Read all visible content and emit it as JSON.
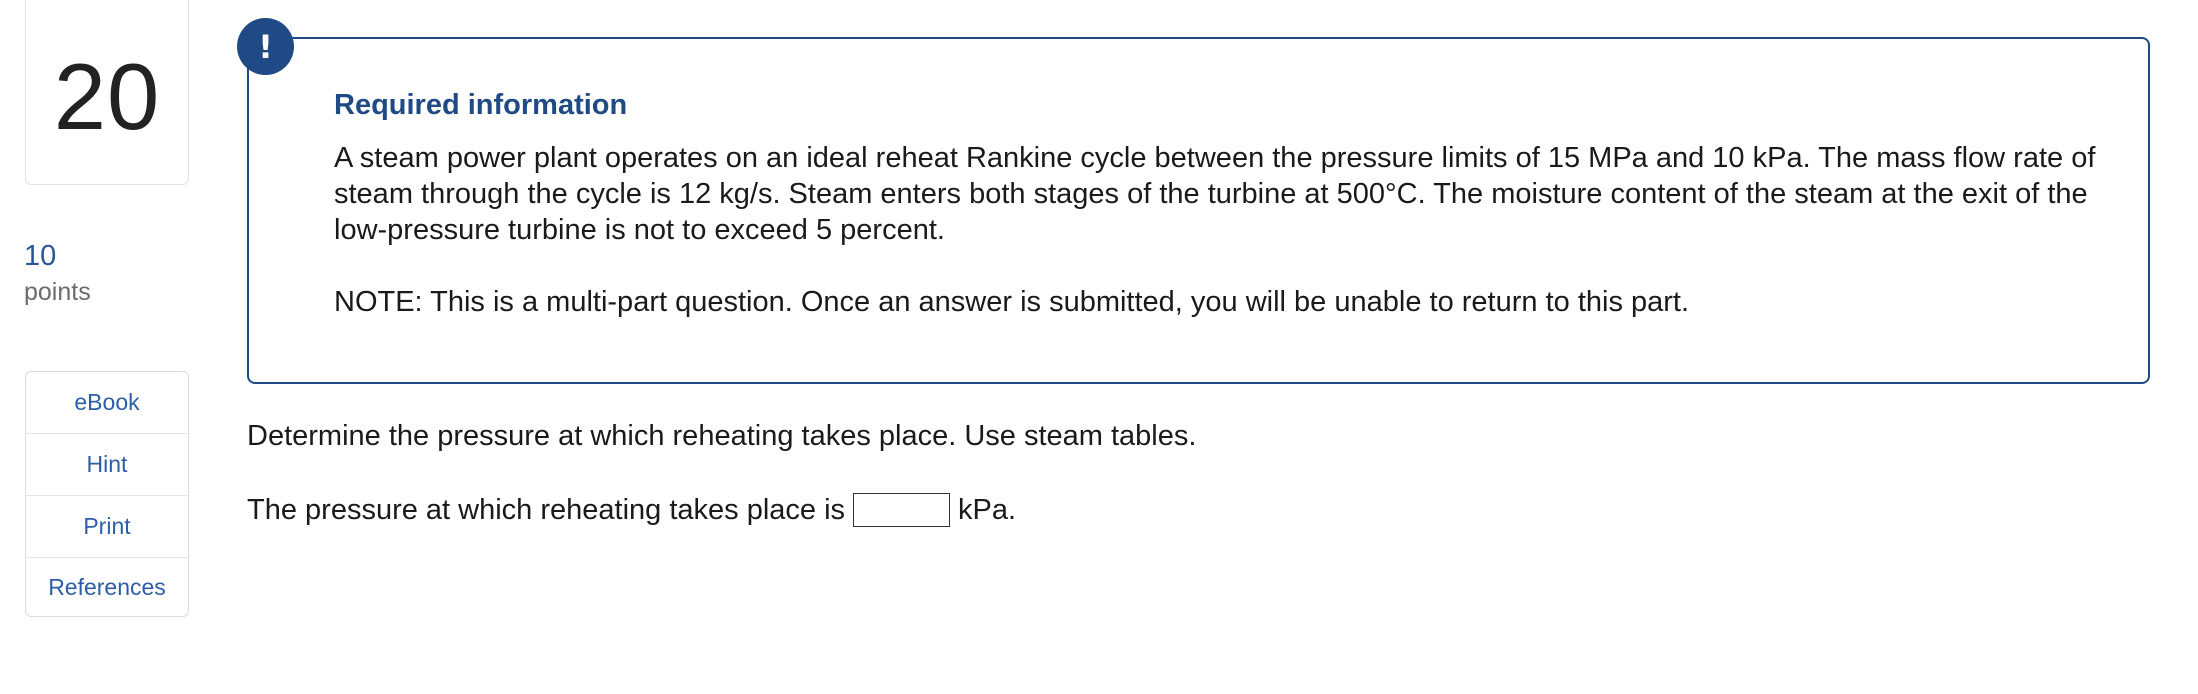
{
  "question": {
    "number": "20",
    "points_value": "10",
    "points_label": "points"
  },
  "tools": [
    {
      "label": "eBook"
    },
    {
      "label": "Hint"
    },
    {
      "label": "Print"
    },
    {
      "label": "References"
    }
  ],
  "info": {
    "badge": "!",
    "title": "Required information",
    "body": "A steam power plant operates on an ideal reheat Rankine cycle between the pressure limits of 15 MPa and 10 kPa. The mass flow rate of steam through the cycle is 12 kg/s. Steam enters both stages of the turbine at 500°C. The moisture content of the steam at the exit of the low-pressure turbine is not to exceed 5 percent.",
    "note": "NOTE: This is a multi-part question. Once an answer is submitted, you will be unable to return to this part."
  },
  "prompt": {
    "text": "Determine the pressure at which reheating takes place. Use steam tables.",
    "answer_prefix": "The pressure at which reheating takes place is",
    "answer_value": "",
    "answer_unit": "kPa."
  }
}
